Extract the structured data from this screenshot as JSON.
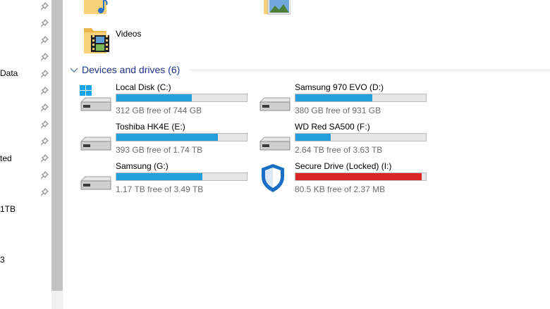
{
  "nav": {
    "items": [
      {
        "label": "Data"
      },
      {
        "label": "ted"
      },
      {
        "label": "1TB"
      },
      {
        "label": "3"
      }
    ]
  },
  "folders": [
    {
      "label": "",
      "icon": "music-folder-icon"
    },
    {
      "label": "",
      "icon": "pictures-folder-icon"
    },
    {
      "label": "Videos",
      "icon": "videos-folder-icon"
    }
  ],
  "section": {
    "title": "Devices and drives (6)"
  },
  "drives": [
    {
      "name": "Local Disk (C:)",
      "free": "312 GB free of 744 GB",
      "used_fraction": 0.58,
      "bar_color": "#26a0da",
      "icon": "windows-drive-icon"
    },
    {
      "name": "Samsung 970 EVO (D:)",
      "free": "380 GB free of 931 GB",
      "used_fraction": 0.59,
      "bar_color": "#26a0da",
      "icon": "hard-drive-icon"
    },
    {
      "name": "Toshiba HK4E (E:)",
      "free": "393 GB free of 1.74 TB",
      "used_fraction": 0.78,
      "bar_color": "#26a0da",
      "icon": "hard-drive-icon"
    },
    {
      "name": "WD Red SA500 (F:)",
      "free": "2.64 TB free of 3.63 TB",
      "used_fraction": 0.27,
      "bar_color": "#26a0da",
      "icon": "hard-drive-icon"
    },
    {
      "name": "Samsung  (G:)",
      "free": "1.17 TB free of 3.49 TB",
      "used_fraction": 0.66,
      "bar_color": "#26a0da",
      "icon": "hard-drive-icon"
    },
    {
      "name": "Secure Drive (Locked) (I:)",
      "free": "80.5 KB free of 2.37 MB",
      "used_fraction": 0.97,
      "bar_color": "#da2626",
      "icon": "shield-icon"
    }
  ]
}
